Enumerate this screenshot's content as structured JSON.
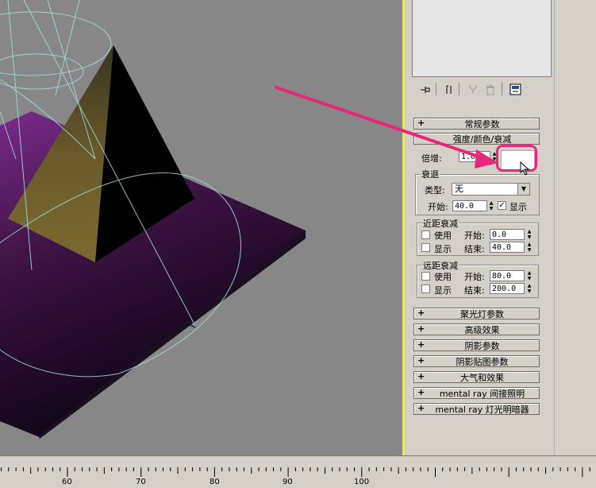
{
  "ruler": {
    "labels": [
      "60",
      "70",
      "80",
      "90",
      "100"
    ]
  },
  "toolbar": {
    "icons": [
      "pin-icon",
      "stack-icon",
      "funnel-icon",
      "trash-icon",
      "configure-icon"
    ]
  },
  "rollouts": {
    "general": "常规参数",
    "intensity": "强度/颜色/衰减",
    "spotlight": "聚光灯参数",
    "advanced": "高级效果",
    "shadow": "阴影参数",
    "shadow_map": "阴影贴图参数",
    "atmosphere": "大气和效果",
    "mr_indirect": "mental ray 间接照明",
    "mr_shader": "mental ray 灯光明暗器"
  },
  "intensity": {
    "multiplier_label": "倍增:",
    "multiplier_value": "1.0",
    "decay_group": "衰退",
    "type_label": "类型:",
    "type_value": "无",
    "start_label": "开始:",
    "start_value": "40.0",
    "show_label": "显示",
    "near_group": "近距衰减",
    "use_label": "使用",
    "near_start_label": "开始:",
    "near_start_value": "0.0",
    "end_label": "结束:",
    "near_end_value": "40.0",
    "far_group": "远距衰减",
    "far_start_value": "80.0",
    "far_end_value": "200.0"
  },
  "colors": {
    "highlight": "#e8287a",
    "viewport_border": "#f6f200",
    "swatch": "#ffffff"
  }
}
